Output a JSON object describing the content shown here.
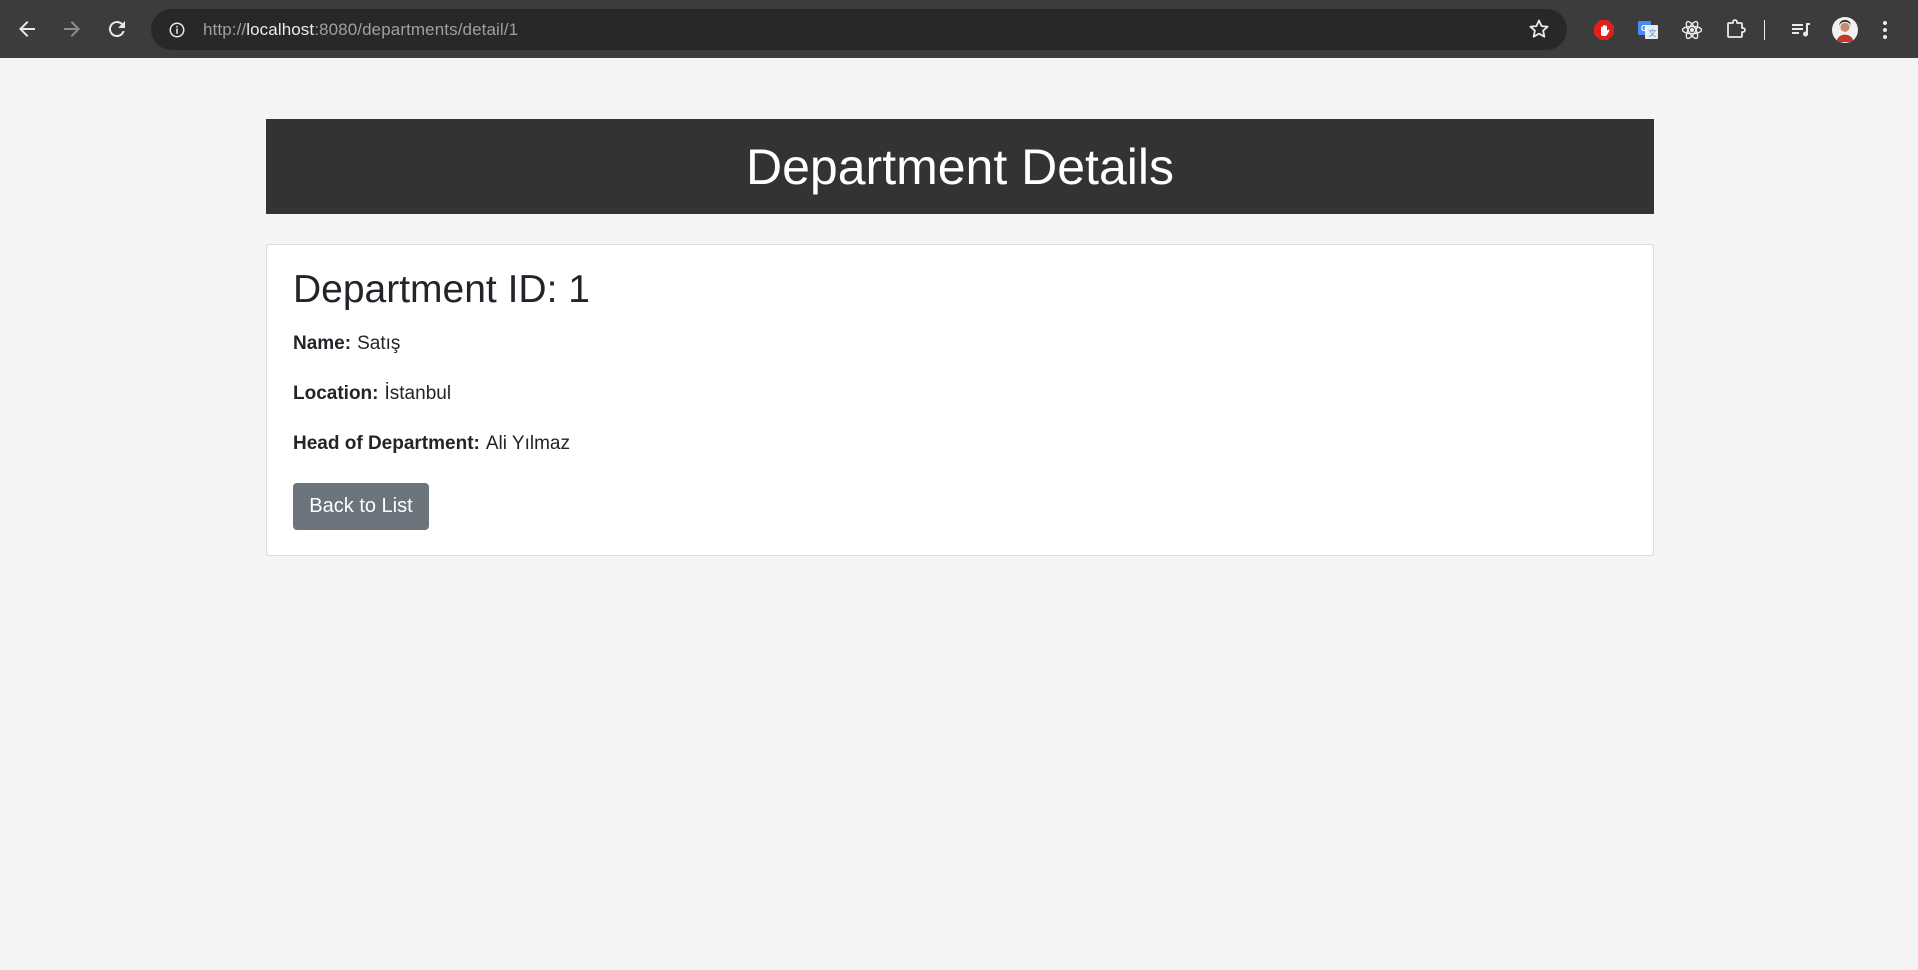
{
  "browser": {
    "url_scheme": "http://",
    "url_host": "localhost",
    "url_rest": ":8080/departments/detail/1"
  },
  "page": {
    "header_title": "Department Details",
    "card_title": "Department ID: 1",
    "fields": [
      {
        "label": "Name:",
        "value": "Satış"
      },
      {
        "label": "Location:",
        "value": "İstanbul"
      },
      {
        "label": "Head of Department:",
        "value": "Ali Yılmaz"
      }
    ],
    "back_button_label": "Back to List"
  },
  "colors": {
    "header_bg": "#333333",
    "button_bg": "#6c757d",
    "page_bg": "#f4f4f4"
  }
}
